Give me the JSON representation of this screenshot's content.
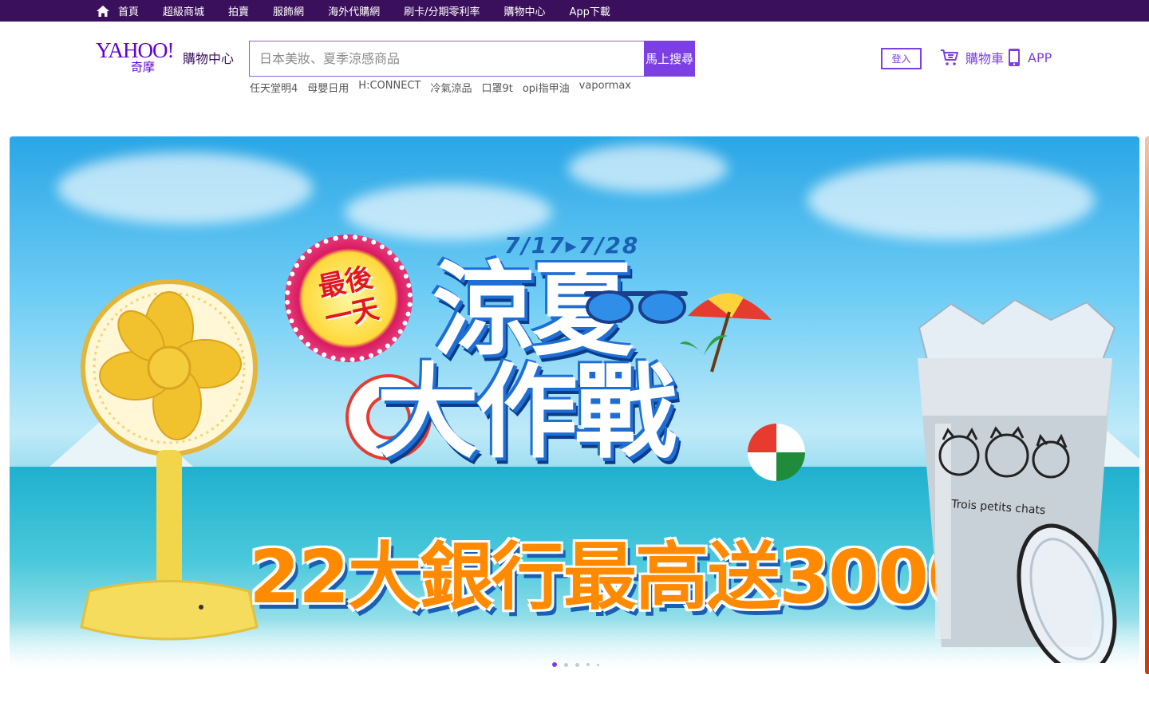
{
  "topnav": {
    "items": [
      {
        "label": "首頁",
        "icon": "home-icon"
      },
      {
        "label": "超級商城"
      },
      {
        "label": "拍賣"
      },
      {
        "label": "服飾網"
      },
      {
        "label": "海外代購網"
      },
      {
        "label": "刷卡/分期零利率"
      },
      {
        "label": "購物中心"
      },
      {
        "label": "App下載"
      }
    ]
  },
  "header": {
    "logo": {
      "brand": "YAHOO!",
      "sub": "奇摩",
      "section": "購物中心"
    },
    "search": {
      "placeholder": "日本美妝、夏季涼感商品",
      "button": "馬上搜尋"
    },
    "hot_keywords": [
      "任天堂明4",
      "母嬰日用",
      "H:CONNECT",
      "冷氣涼品",
      "口罩9t",
      "opi指甲油",
      "vapormax"
    ],
    "login_label": "登入",
    "cart_label": "購物車",
    "app_label": "APP"
  },
  "banner": {
    "date": "7/17▸7/28",
    "badge_line1": "最後",
    "badge_line2": "一天",
    "title_line1": "涼夏",
    "title_line2": "大作戰",
    "promo": "22大銀行最高送3000",
    "tumbler_text": "Trois petits chats",
    "slides_total": 5,
    "active_slide": 1
  },
  "colors": {
    "topnav_bg": "#3a0f5c",
    "brand_purple": "#7b3fe4",
    "logo_purple": "#5f01d1"
  }
}
